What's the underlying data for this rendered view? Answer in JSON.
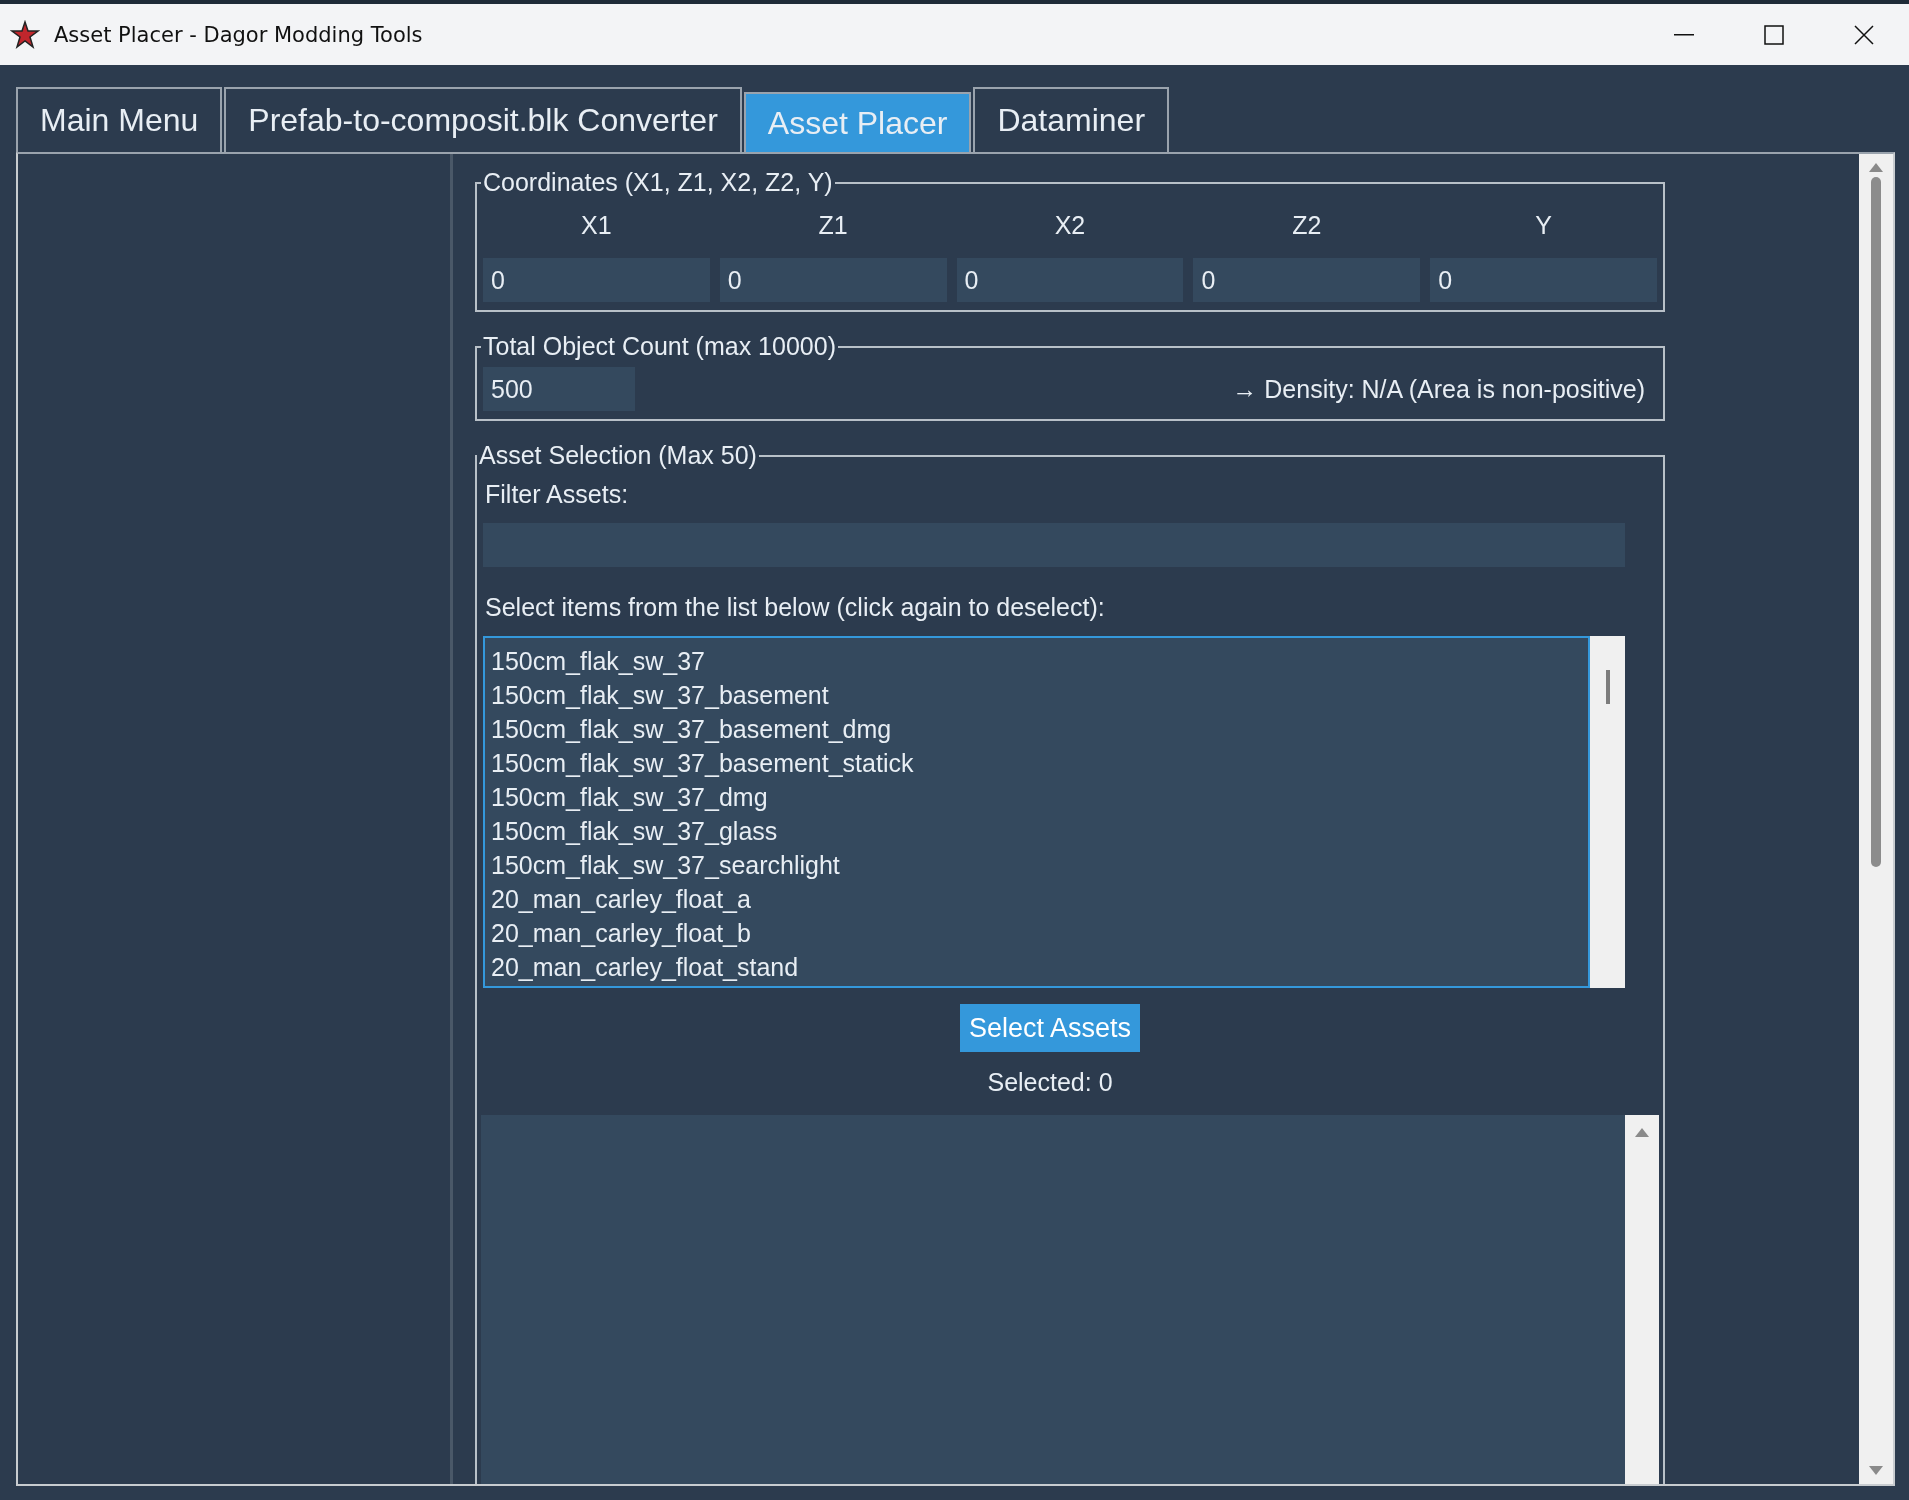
{
  "window": {
    "title": "Asset Placer - Dagor Modding Tools"
  },
  "tabs": [
    {
      "label": "Main Menu",
      "selected": false
    },
    {
      "label": "Prefab-to-composit.blk Converter",
      "selected": false
    },
    {
      "label": "Asset Placer",
      "selected": true
    },
    {
      "label": "Dataminer",
      "selected": false
    }
  ],
  "coordinates": {
    "title": "Coordinates (X1, Z1, X2, Z2, Y)",
    "fields": [
      {
        "label": "X1",
        "value": "0"
      },
      {
        "label": "Z1",
        "value": "0"
      },
      {
        "label": "X2",
        "value": "0"
      },
      {
        "label": "Z2",
        "value": "0"
      },
      {
        "label": "Y",
        "value": "0"
      }
    ]
  },
  "object_count": {
    "title": "Total Object Count (max 10000)",
    "value": "500",
    "density": "→ Density: N/A (Area is non-positive)"
  },
  "asset_selection": {
    "title": "Asset Selection (Max 50)",
    "filter_label": "Filter Assets:",
    "list_hint": "Select items from the list below (click again to deselect):",
    "items": [
      {
        "label": "150cm_flak_sw_37",
        "selected": false
      },
      {
        "label": "150cm_flak_sw_37_basement",
        "selected": false
      },
      {
        "label": "150cm_flak_sw_37_basement_dmg",
        "selected": false
      },
      {
        "label": "150cm_flak_sw_37_basement_statick",
        "selected": false
      },
      {
        "label": "150cm_flak_sw_37_dmg",
        "selected": false
      },
      {
        "label": "150cm_flak_sw_37_glass",
        "selected": false
      },
      {
        "label": "150cm_flak_sw_37_searchlight",
        "selected": false
      },
      {
        "label": "20_man_carley_float_a",
        "selected": false
      },
      {
        "label": "20_man_carley_float_b",
        "selected": false
      },
      {
        "label": "20_man_carley_float_stand",
        "selected": false
      }
    ],
    "button": "Select Assets",
    "selected_count": "Selected: 0"
  }
}
